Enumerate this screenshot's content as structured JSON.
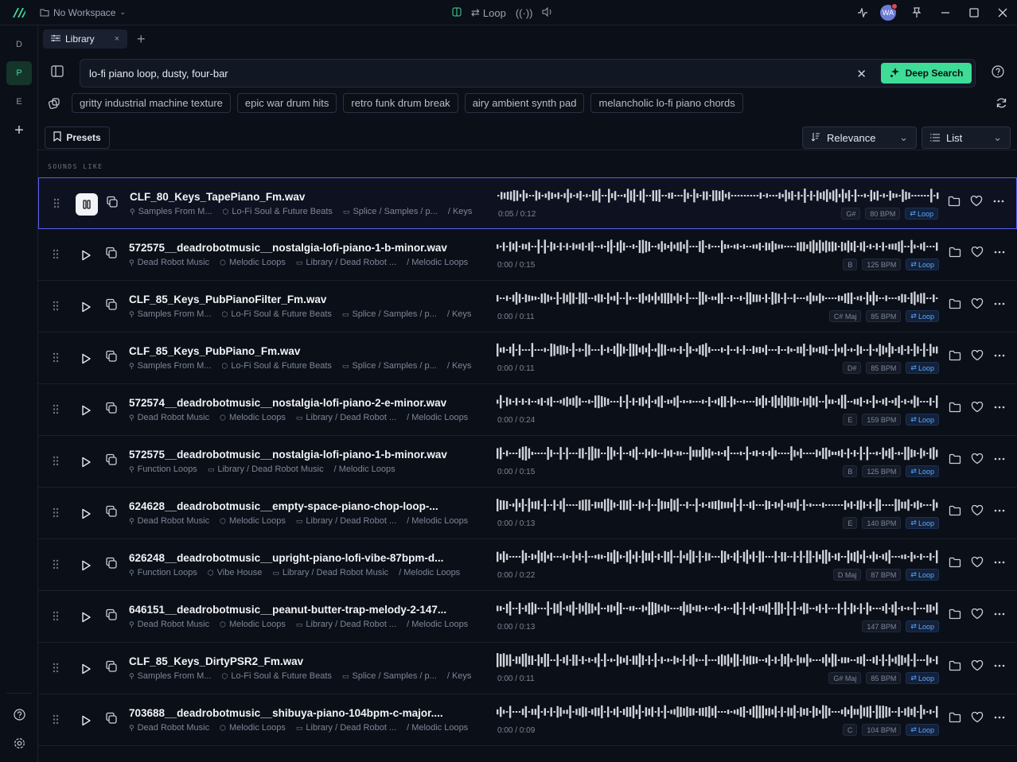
{
  "titlebar": {
    "workspace": "No Workspace",
    "loop_label": "Loop",
    "avatar_initials": "WA"
  },
  "leftbar": {
    "items": [
      "D",
      "P",
      "E"
    ],
    "active_index": 1
  },
  "tabs": [
    {
      "label": "Library"
    }
  ],
  "search": {
    "query": "lo-fi piano loop, dusty, four-bar",
    "deep_search_label": "Deep Search"
  },
  "suggestions": [
    "gritty industrial machine texture",
    "epic war drum hits",
    "retro funk drum break",
    "airy ambient synth pad",
    "melancholic lo-fi piano chords"
  ],
  "toolbar": {
    "presets_label": "Presets",
    "sort_label": "Relevance",
    "view_label": "List"
  },
  "section_label": "SOUNDS LIKE",
  "colors": {
    "accent": "#3ddc97",
    "active_border": "#5b5ef0",
    "loop_tag": "#5aa9ff"
  },
  "rows": [
    {
      "name": "CLF_80_Keys_TapePiano_Fm.wav",
      "meta": [
        "Samples From M...",
        "Lo-Fi Soul & Future Beats",
        "Splice / Samples / p...",
        "/ Keys"
      ],
      "time": "0:05 / 0:12",
      "key": "G#",
      "bpm": "80 BPM",
      "loop": "Loop",
      "playing": true,
      "seed": 3
    },
    {
      "name": "572575__deadrobotmusic__nostalgia-lofi-piano-1-b-minor.wav",
      "meta": [
        "Dead Robot Music",
        "Melodic Loops",
        "Library / Dead Robot ...",
        "/ Melodic Loops"
      ],
      "time": "0:00 / 0:15",
      "key": "B",
      "bpm": "125 BPM",
      "loop": "Loop",
      "playing": false,
      "seed": 7
    },
    {
      "name": "CLF_85_Keys_PubPianoFilter_Fm.wav",
      "meta": [
        "Samples From M...",
        "Lo-Fi Soul & Future Beats",
        "Splice / Samples / p...",
        "/ Keys"
      ],
      "time": "0:00 / 0:11",
      "key": "C# Maj",
      "bpm": "85 BPM",
      "loop": "Loop",
      "playing": false,
      "seed": 11
    },
    {
      "name": "CLF_85_Keys_PubPiano_Fm.wav",
      "meta": [
        "Samples From M...",
        "Lo-Fi Soul & Future Beats",
        "Splice / Samples / p...",
        "/ Keys"
      ],
      "time": "0:00 / 0:11",
      "key": "D#",
      "bpm": "85 BPM",
      "loop": "Loop",
      "playing": false,
      "seed": 13
    },
    {
      "name": "572574__deadrobotmusic__nostalgia-lofi-piano-2-e-minor.wav",
      "meta": [
        "Dead Robot Music",
        "Melodic Loops",
        "Library / Dead Robot ...",
        "/ Melodic Loops"
      ],
      "time": "0:00 / 0:24",
      "key": "E",
      "bpm": "159 BPM",
      "loop": "Loop",
      "playing": false,
      "seed": 17
    },
    {
      "name": "572575__deadrobotmusic__nostalgia-lofi-piano-1-b-minor.wav",
      "meta": [
        "Function Loops",
        "Library / Dead Robot Music",
        "/ Melodic Loops"
      ],
      "time": "0:00 / 0:15",
      "key": "B",
      "bpm": "125 BPM",
      "loop": "Loop",
      "playing": false,
      "seed": 19
    },
    {
      "name": "624628__deadrobotmusic__empty-space-piano-chop-loop-...",
      "meta": [
        "Dead Robot Music",
        "Melodic Loops",
        "Library / Dead Robot ...",
        "/ Melodic Loops"
      ],
      "time": "0:00 / 0:13",
      "key": "E",
      "bpm": "140 BPM",
      "loop": "Loop",
      "playing": false,
      "seed": 23
    },
    {
      "name": "626248__deadrobotmusic__upright-piano-lofi-vibe-87bpm-d...",
      "meta": [
        "Function Loops",
        "Vibe House",
        "Library / Dead Robot Music",
        "/ Melodic Loops"
      ],
      "time": "0:00 / 0:22",
      "key": "D Maj",
      "bpm": "87 BPM",
      "loop": "Loop",
      "playing": false,
      "seed": 29
    },
    {
      "name": "646151__deadrobotmusic__peanut-butter-trap-melody-2-147...",
      "meta": [
        "Dead Robot Music",
        "Melodic Loops",
        "Library / Dead Robot ...",
        "/ Melodic Loops"
      ],
      "time": "0:00 / 0:13",
      "key": "",
      "bpm": "147 BPM",
      "loop": "Loop",
      "playing": false,
      "seed": 31
    },
    {
      "name": "CLF_85_Keys_DirtyPSR2_Fm.wav",
      "meta": [
        "Samples From M...",
        "Lo-Fi Soul & Future Beats",
        "Splice / Samples / p...",
        "/ Keys"
      ],
      "time": "0:00 / 0:11",
      "key": "G# Maj",
      "bpm": "85 BPM",
      "loop": "Loop",
      "playing": false,
      "seed": 37
    },
    {
      "name": "703688__deadrobotmusic__shibuya-piano-104bpm-c-major....",
      "meta": [
        "Dead Robot Music",
        "Melodic Loops",
        "Library / Dead Robot ...",
        "/ Melodic Loops"
      ],
      "time": "0:00 / 0:09",
      "key": "C",
      "bpm": "104 BPM",
      "loop": "Loop",
      "playing": false,
      "seed": 41
    }
  ]
}
